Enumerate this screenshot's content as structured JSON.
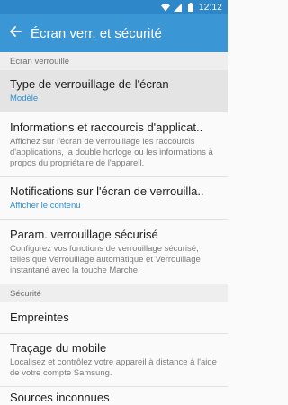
{
  "status_bar": {
    "time": "12:12",
    "icons": [
      "wifi-icon",
      "signal-icon",
      "battery-icon"
    ]
  },
  "app_bar": {
    "title": "Écran verr. et sécurité",
    "back_icon": "arrow-back-icon"
  },
  "colors": {
    "status_bar": "#2e87c8",
    "app_bar": "#3b96d6",
    "accent": "#2b8fd6",
    "section_bg": "#eeeeee"
  },
  "sections": {
    "lock_screen": "Écran verrouillé",
    "security": "Sécurité"
  },
  "items": {
    "lock_type": {
      "title": "Type de verrouillage de l'écran",
      "subtitle": "Modèle"
    },
    "info_shortcuts": {
      "title": "Informations et raccourcis d'applicat..",
      "subtitle": "Affichez sur l'écran de verrouillage les raccourcis d'applications, la double horloge ou les informations à propos du propriétaire de l'appareil."
    },
    "notifications": {
      "title": "Notifications sur l'écran de verrouilla..",
      "subtitle": "Afficher le contenu"
    },
    "secure_lock": {
      "title": "Param. verrouillage sécurisé",
      "subtitle": "Configurez vos fonctions de verrouillage sécurisé, telles que Verrouillage automatique et Verrouillage instantané avec la touche Marche."
    },
    "fingerprints": {
      "title": "Empreintes"
    },
    "find_mobile": {
      "title": "Traçage du mobile",
      "subtitle": "Localisez et contrôlez votre appareil à distance à l'aide de votre compte Samsung."
    },
    "unknown_sources": {
      "title": "Sources inconnues"
    }
  }
}
